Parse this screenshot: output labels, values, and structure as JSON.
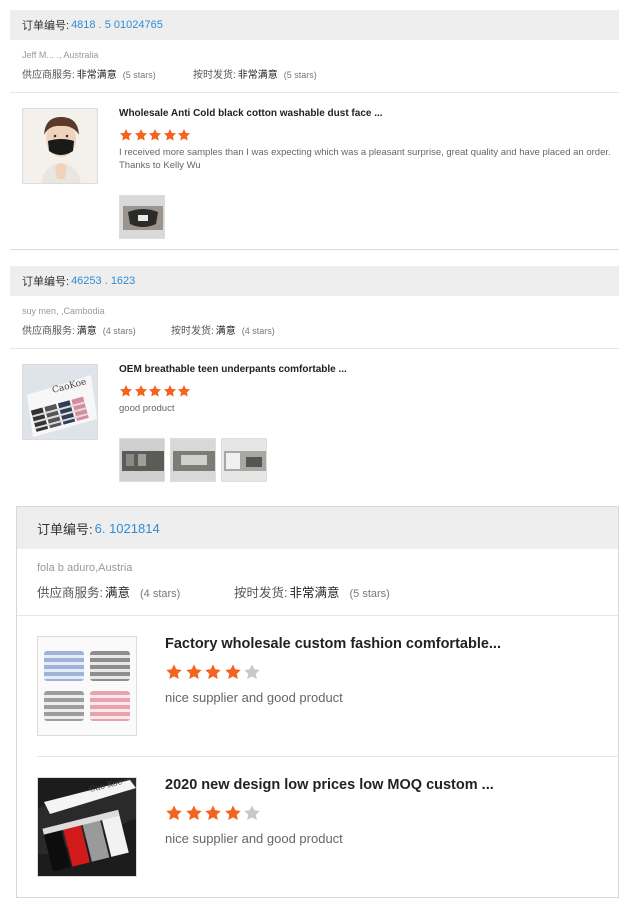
{
  "colors": {
    "accent": "#2d8cd8",
    "star_on": "#f5641e",
    "star_off": "#c8c8c8",
    "header_bg": "#eeeeee"
  },
  "orders": [
    {
      "label": "订单编号:",
      "order_no": "4818 . 5 01024765",
      "buyer": "Jeff M... ., Australia",
      "supplier_label": "供应商服务:",
      "supplier_value": "非常满意",
      "supplier_count": "(5 stars)",
      "shipping_label": "按时发货:",
      "shipping_value": "非常满意",
      "shipping_count": "(5 stars)",
      "reviews": [
        {
          "title": "Wholesale Anti Cold black cotton washable dust face ...",
          "stars": 5,
          "comment": "I received more samples than I was expecting which was a pleasant surprise, great quality and have placed an order. Thanks to Kelly Wu",
          "thumb_icon": "face-mask-product-image",
          "photos": [
            "mask-photo"
          ]
        }
      ]
    },
    {
      "label": "订单编号:",
      "order_no": "46253 . 1623",
      "buyer": "suy men, ,Cambodia",
      "supplier_label": "供应商服务:",
      "supplier_value": "满意",
      "supplier_count": "(4 stars)",
      "shipping_label": "按时发货:",
      "shipping_value": "满意",
      "shipping_count": "(4 stars)",
      "reviews": [
        {
          "title": "OEM breathable teen underpants comfortable ...",
          "stars": 5,
          "comment": "good product",
          "thumb_icon": "underpants-box-product-image",
          "photos": [
            "photo-1",
            "photo-2",
            "photo-3"
          ]
        }
      ]
    },
    {
      "label": "订单编号:",
      "order_no": "6. 1021814",
      "buyer": "fola b aduro,Austria",
      "supplier_label": "供应商服务:",
      "supplier_value": "满意",
      "supplier_count": "(4 stars)",
      "shipping_label": "按时发货:",
      "shipping_value": "非常满意",
      "shipping_count": "(5 stars)",
      "reviews": [
        {
          "title": "Factory wholesale custom fashion comfortable...",
          "stars": 4,
          "comment": "nice supplier and good product",
          "thumb_icon": "striped-boxers-product-image"
        },
        {
          "title": "2020 new design low prices low MOQ custom ...",
          "stars": 4,
          "comment": "nice supplier and good product",
          "thumb_icon": "boxers-gift-box-product-image"
        }
      ]
    }
  ]
}
